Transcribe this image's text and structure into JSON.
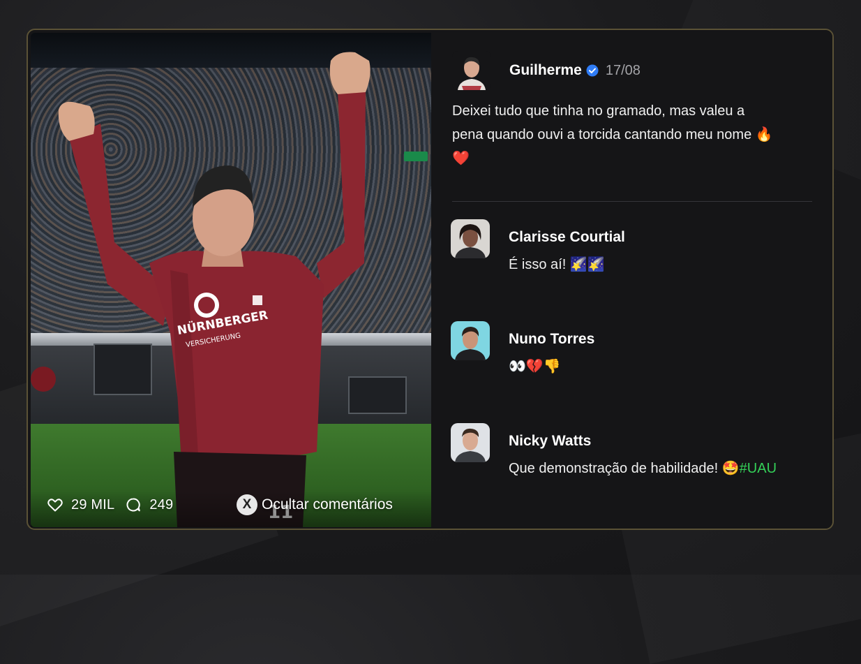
{
  "post": {
    "author": "Guilherme",
    "verified": true,
    "date": "17/08",
    "text_line1": "Deixei tudo que tinha no gramado, mas valeu a",
    "text_line2": "pena quando ouvi a torcida cantando meu nome",
    "emoji_fire": "🔥",
    "emoji_heart": "❤️",
    "likes": "29 MIL",
    "comments_count": "249",
    "hide_comments_label": "Ocultar comentários",
    "hide_comments_key": "X",
    "photo_sponsor_text": "NÜRNBERGER",
    "photo_sponsor_sub": "VERSICHERUNG",
    "photo_shirt_number": "11"
  },
  "comments": [
    {
      "name": "Clarisse Courtial",
      "text": "É isso aí! ",
      "emojis": "🌠🌠"
    },
    {
      "name": "Nuno Torres",
      "text": "",
      "emojis": "👀💔👎"
    },
    {
      "name": "Nicky Watts",
      "text": "Que demonstração de habilidade! ",
      "emojis": "🤩",
      "hashtag": "#UAU"
    }
  ],
  "colors": {
    "card_border": "#5b5236",
    "hashtag": "#34d058",
    "verified": "#2f7cf6",
    "date": "#a4a4a8"
  }
}
